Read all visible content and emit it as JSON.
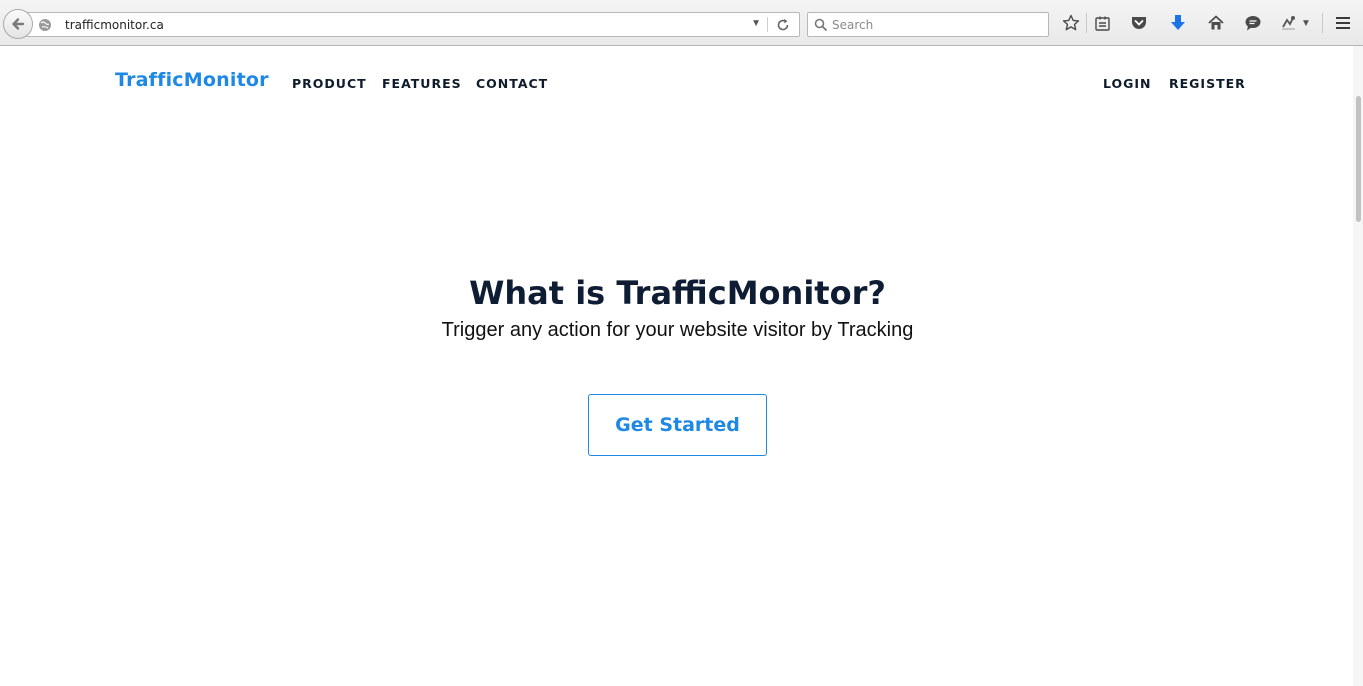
{
  "browser": {
    "url": "trafficmonitor.ca",
    "search_placeholder": "Search",
    "icons": [
      "back-icon",
      "globe-icon",
      "dropdown-arrow-icon",
      "reload-icon",
      "search-icon",
      "star-icon",
      "reading-list-icon",
      "pocket-icon",
      "download-icon",
      "home-icon",
      "chat-icon",
      "extension-icon",
      "menu-icon"
    ],
    "accent_color": "#1a73e8"
  },
  "site": {
    "logo": "TrafficMonitor",
    "nav": {
      "product": "PRODUCT",
      "features": "FEATURES",
      "contact": "CONTACT",
      "login": "LOGIN",
      "register": "REGISTER"
    },
    "hero": {
      "title": "What is TrafficMonitor?",
      "subtitle": "Trigger any action for your website visitor by Tracking",
      "cta": "Get Started"
    },
    "brand_color": "#1e88e5",
    "text_color": "#0e1d33"
  }
}
